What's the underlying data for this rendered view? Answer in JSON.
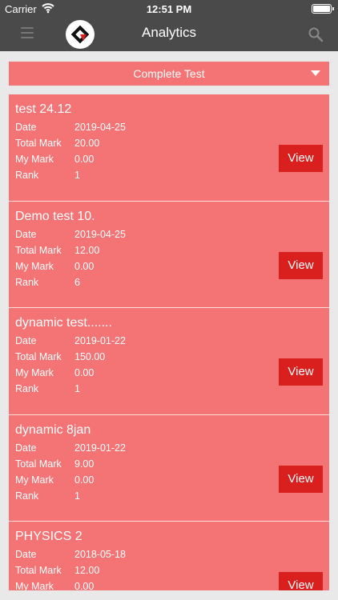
{
  "status_bar": {
    "carrier": "Carrier",
    "time": "12:51 PM"
  },
  "nav": {
    "title": "Analytics"
  },
  "filter": {
    "selected": "Complete Test"
  },
  "labels": {
    "date": "Date",
    "total_mark": "Total Mark",
    "my_mark": "My Mark",
    "rank": "Rank",
    "view": "View"
  },
  "tests": [
    {
      "name": "test 24.12",
      "date": "2019-04-25",
      "total_mark": "20.00",
      "my_mark": "0.00",
      "rank": "1"
    },
    {
      "name": "Demo test 10.",
      "date": "2019-04-25",
      "total_mark": "12.00",
      "my_mark": "0.00",
      "rank": "6"
    },
    {
      "name": "dynamic test.......",
      "date": "2019-01-22",
      "total_mark": "150.00",
      "my_mark": "0.00",
      "rank": "1"
    },
    {
      "name": "dynamic 8jan",
      "date": "2019-01-22",
      "total_mark": "9.00",
      "my_mark": "0.00",
      "rank": "1"
    },
    {
      "name": "PHYSICS 2",
      "date": "2018-05-18",
      "total_mark": "12.00",
      "my_mark": "0.00",
      "rank": ""
    }
  ],
  "colors": {
    "header": "#4a4a4a",
    "card": "#f47375",
    "button": "#d9201f",
    "background": "#e9e9e9"
  },
  "icons": {
    "menu": "hamburger-icon",
    "logo": "app-logo",
    "search": "search-icon",
    "dropdown": "caret-down-icon"
  }
}
